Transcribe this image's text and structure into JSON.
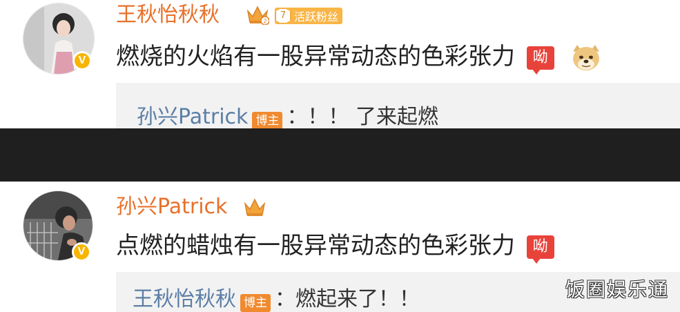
{
  "comments": [
    {
      "username": "王秋怡秋秋",
      "fan_badge": {
        "level": "7",
        "label": "活跃粉丝"
      },
      "verified_badge": "V",
      "text": "燃烧的火焰有一股异常动态的色彩张力",
      "emojis": [
        "ou-text-sticker",
        "doge-emoji"
      ],
      "reply": {
        "author": "孙兴Patrick",
        "tag": "博主",
        "text": "：！！ 了来起燃"
      }
    },
    {
      "username": "孙兴Patrick",
      "verified_badge": "V",
      "text": "点燃的蜡烛有一股异常动态的色彩张力",
      "emojis": [
        "ou-text-sticker"
      ],
      "reply": {
        "author": "王秋怡秋秋",
        "tag": "博主",
        "text": "：燃起来了！！"
      }
    }
  ],
  "emoji_label": "呦",
  "watermark": "饭圈娱乐通",
  "colors": {
    "username": "#e8702a",
    "reply_name": "#5b7ea6",
    "blogger_tag": "#f08a2f",
    "band": "#1f1f1f"
  }
}
